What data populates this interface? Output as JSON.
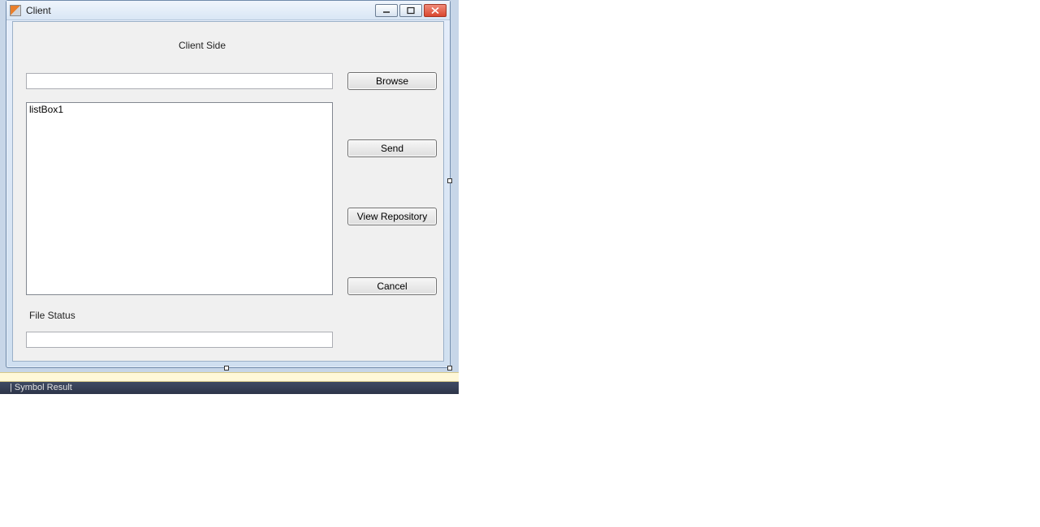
{
  "window": {
    "title": "Client"
  },
  "form": {
    "heading": "Client Side",
    "file_path_value": "",
    "listbox_items": [
      "listBox1"
    ],
    "file_status_label": "File Status",
    "file_status_value": ""
  },
  "buttons": {
    "browse": "Browse",
    "send": "Send",
    "view_repository": "View Repository",
    "cancel": "Cancel"
  },
  "footer": {
    "text": "| Symbol Result"
  }
}
